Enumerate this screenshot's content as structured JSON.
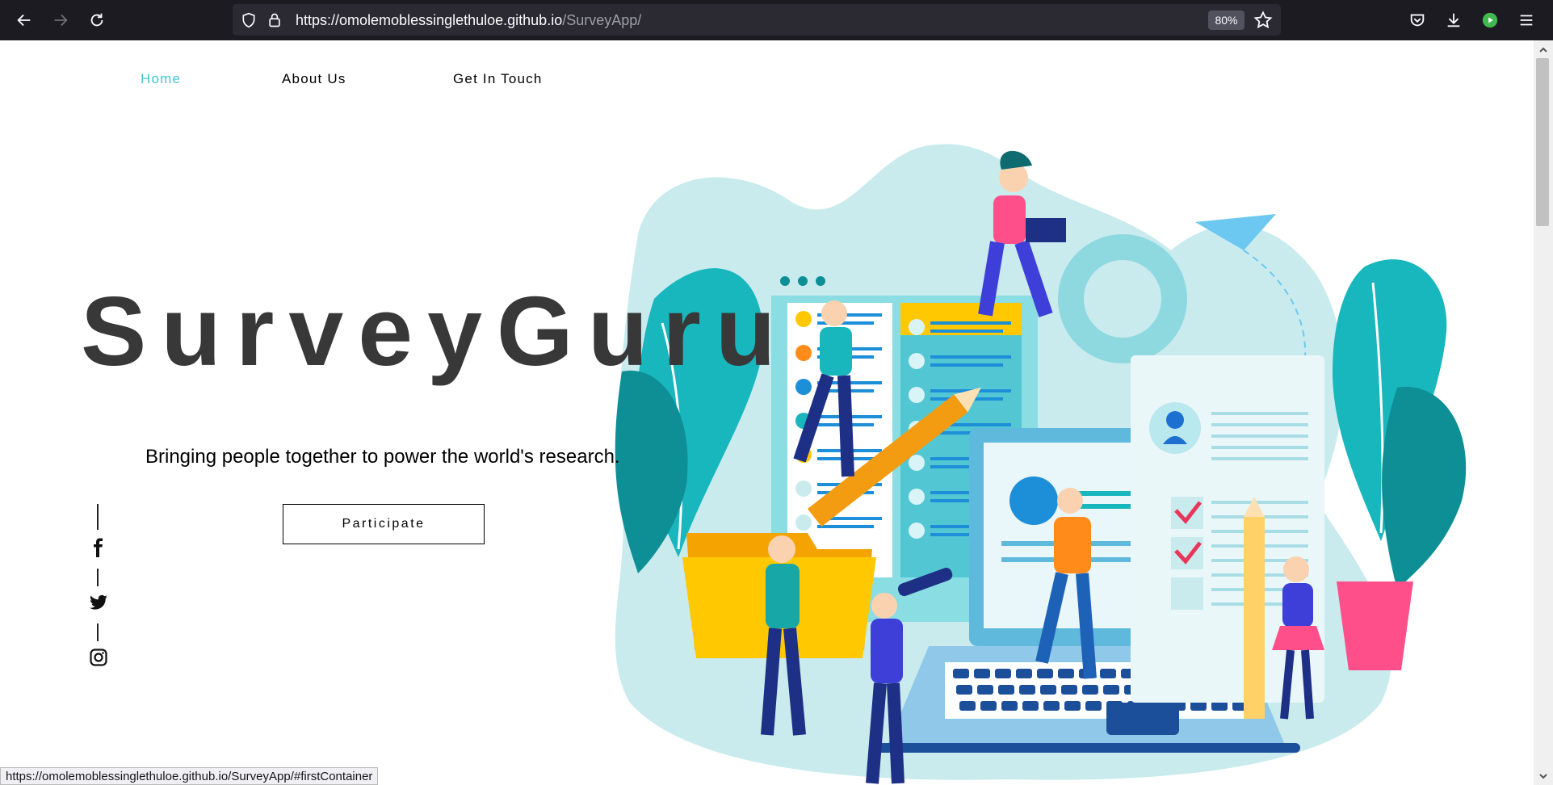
{
  "browser": {
    "url_host": "https://omolemoblessinglethuloe.github.io",
    "url_path": "/SurveyApp/",
    "zoom": "80%",
    "status_url": "https://omolemoblessinglethuloe.github.io/SurveyApp/#firstContainer"
  },
  "nav": {
    "items": [
      {
        "label": "Home",
        "active": true
      },
      {
        "label": "About Us",
        "active": false
      },
      {
        "label": "Get In Touch",
        "active": false
      }
    ]
  },
  "hero": {
    "title": "SurveyGuru",
    "subtitle": "Bringing people together to power the world's research.",
    "cta": "Participate"
  },
  "social": [
    "facebook-icon",
    "twitter-icon",
    "instagram-icon"
  ],
  "colors": {
    "accent": "#45c4d0",
    "title": "#383838",
    "teal": "#18b6bd",
    "light_teal": "#c9ebee",
    "yellow": "#ffc800",
    "pink": "#ff4f8b",
    "navy": "#1e2f86"
  }
}
